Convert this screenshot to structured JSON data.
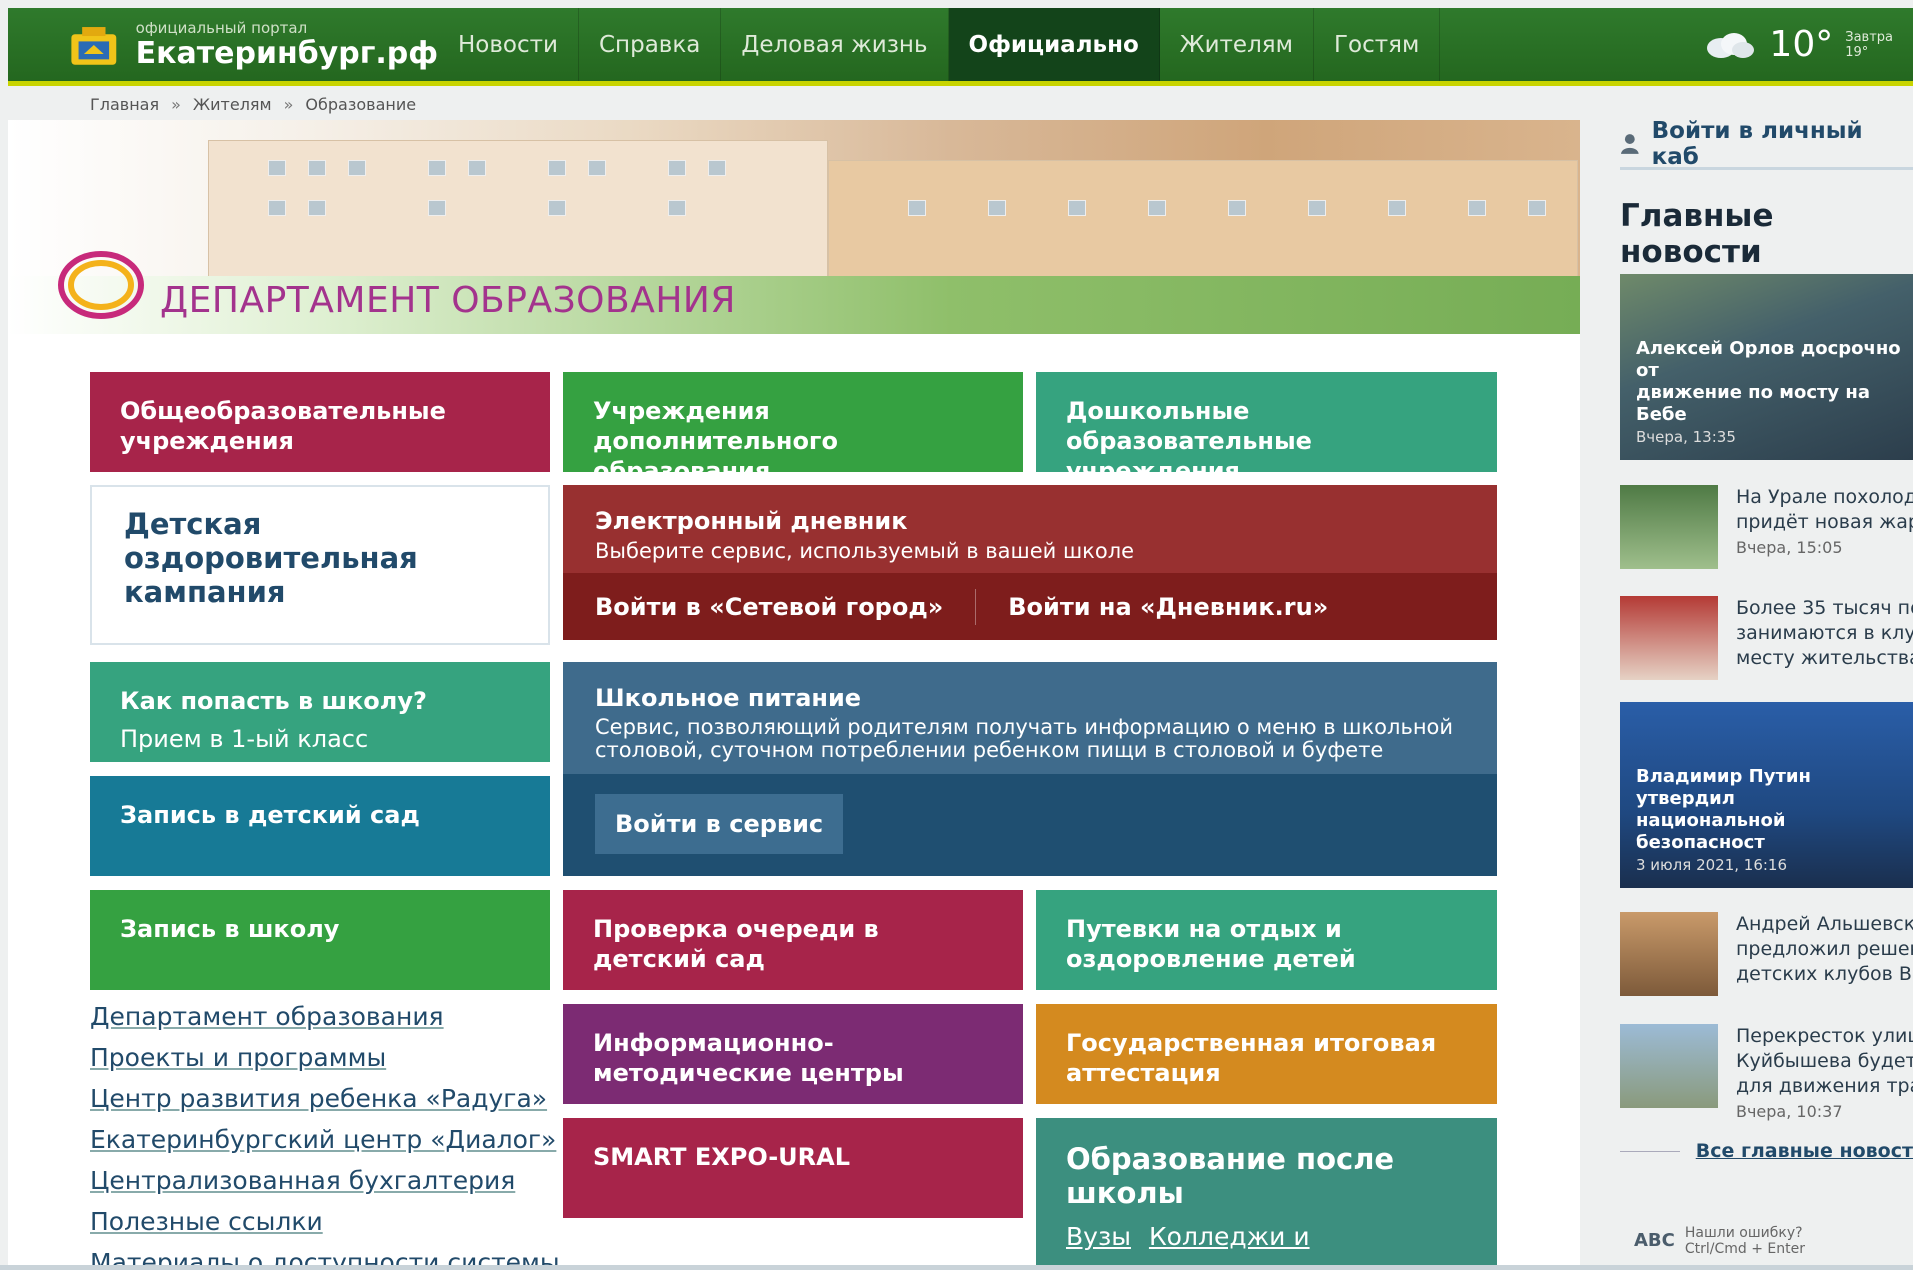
{
  "header": {
    "logo_sub": "официальный портал",
    "logo_title": "Екатеринбург.рф",
    "nav": [
      "Новости",
      "Справка",
      "Деловая жизнь",
      "Официально",
      "Жителям",
      "Гостям"
    ],
    "active_nav": "Официально",
    "weather": {
      "temp": "10°",
      "tomorrow_label": "Завтра",
      "tomorrow_temp": "19°"
    },
    "brand_color": "#2f7a2c",
    "accent_color": "#c8d400"
  },
  "breadcrumbs": [
    "Главная",
    "»",
    "Жителям",
    "»",
    "Образование"
  ],
  "banner": {
    "title": "ДЕПАРТАМЕНТ ОБРАЗОВАНИЯ"
  },
  "tiles": {
    "general_schools": "Общеобразовательные учреждения",
    "additional_edu": "Учреждения дополнительного образования",
    "preschool": "Дошкольные образовательные учреждения",
    "summer_campaign": "Детская оздоровительная кампания",
    "how_school_title": "Как попасть в школу?",
    "how_school_sub": "Прием в 1-ый класс",
    "kindergarten_signup": "Запись в детский сад",
    "school_signup": "Запись в школу",
    "queue_check": "Проверка очереди в детский сад",
    "vouchers": "Путевки на отдых и оздоровление детей",
    "info_centers": "Информационно-методические центры",
    "final_exam": "Государственная итоговая аттестация",
    "smart_expo": "SMART EXPO-URAL",
    "after_school_title": "Образование после школы",
    "after_school_links": [
      "Вузы",
      "Колледжи и техникумы"
    ]
  },
  "diary": {
    "title": "Электронный дневник",
    "subtitle": "Выберите сервис, используемый в вашей школе",
    "link1": "Войти в «Сетевой город»",
    "link2": "Войти на «Дневник.ru»"
  },
  "food": {
    "title": "Школьное питание",
    "subtitle_line1": "Сервис, позволяющий родителям получать информацию о меню в школьной",
    "subtitle_line2": "столовой, суточном потреблении ребенком пищи в столовой и буфете",
    "button": "Войти в сервис"
  },
  "links": [
    "Департамент образования",
    "Проекты и программы",
    "Центр развития ребенка «Радуга»",
    "Екатеринбургский центр «Диалог»",
    "Централизованная бухгалтерия",
    "Полезные ссылки",
    "Материалы о доступности системы"
  ],
  "sidebar": {
    "login": "Войти в личный каб",
    "heading": "Главные новости",
    "news": [
      {
        "line1": "Алексей Орлов досрочно от",
        "line2": "движение по мосту на Бебе",
        "time": "Вчера, 13:35"
      },
      {
        "line1": "На Урале похолод",
        "line2": "придёт новая жар",
        "time": "Вчера, 15:05"
      },
      {
        "line1": "Более 35 тысяч по",
        "line2": "занимаются в клу",
        "line3": "месту жительства"
      },
      {
        "line1": "Владимир Путин утвердил",
        "line2": "национальной безопасност",
        "time": "3 июля 2021, 16:16"
      },
      {
        "line1": "Андрей Альшевск",
        "line2": "предложил решен",
        "line3": "детских клубов Вч"
      },
      {
        "line1": "Перекресток улиц",
        "line2": "Куйбышева будет",
        "line3": "для движения тра",
        "time": "Вчера, 10:37"
      }
    ],
    "all_news": "Все главные новост",
    "error_line1": "Нашли ошибку?",
    "error_line2": "Ctrl/Cmd + Enter",
    "error_logo": "ABC"
  }
}
